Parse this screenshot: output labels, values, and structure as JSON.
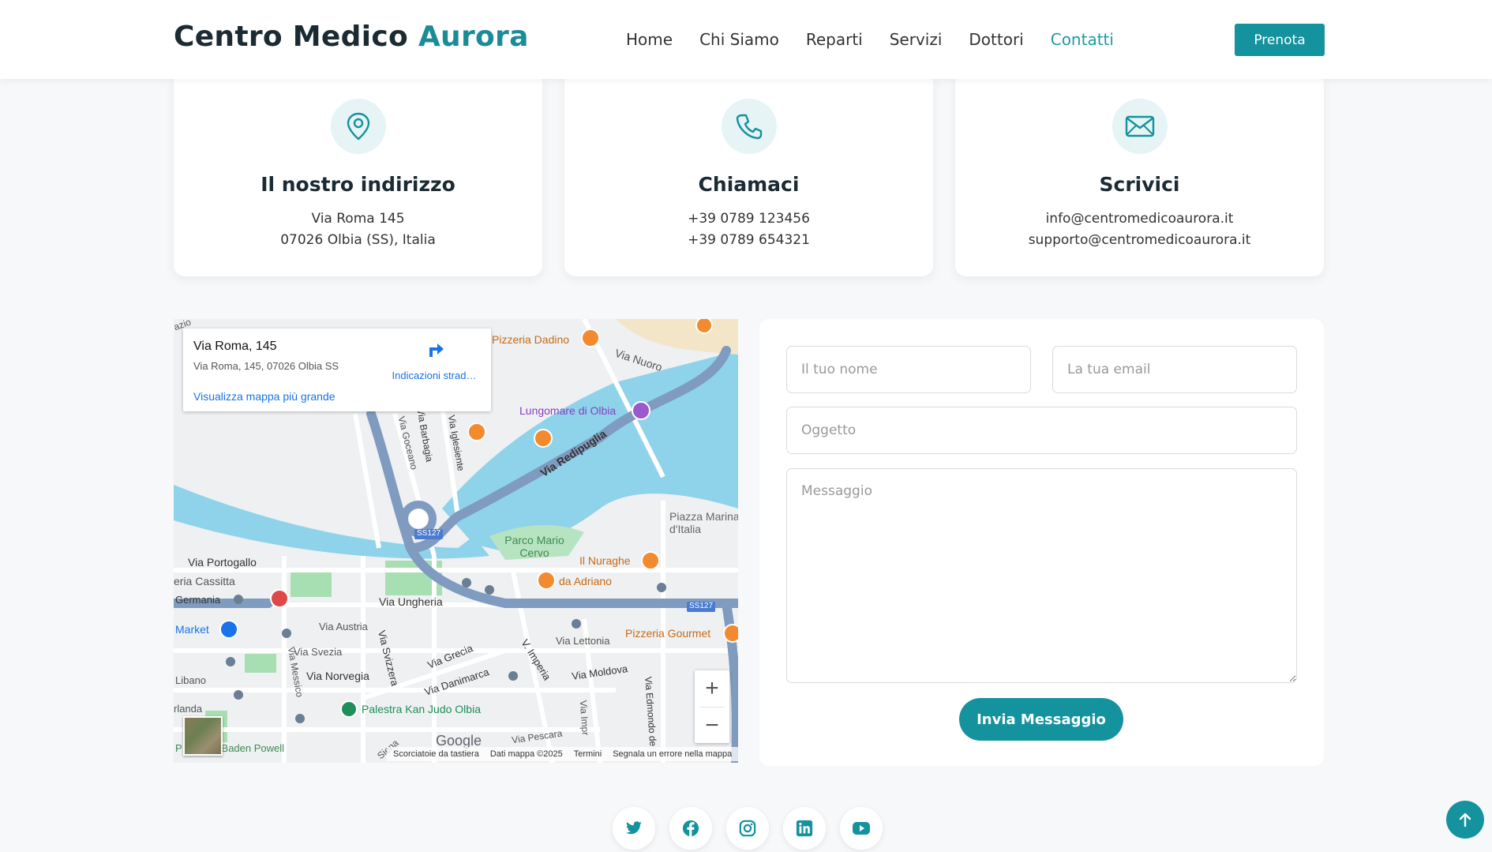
{
  "header": {
    "logo_part1": "Centro Medico ",
    "logo_part2": "Aurora",
    "nav": [
      "Home",
      "Chi Siamo",
      "Reparti",
      "Servizi",
      "Dottori",
      "Contatti"
    ],
    "active_nav": "Contatti",
    "cta_label": "Prenota"
  },
  "cards": [
    {
      "icon": "map-pin-icon",
      "title": "Il nostro indirizzo",
      "lines": [
        "Via Roma 145",
        "07026 Olbia (SS), Italia"
      ]
    },
    {
      "icon": "phone-icon",
      "title": "Chiamaci",
      "lines": [
        "+39 0789 123456",
        "+39 0789 654321"
      ]
    },
    {
      "icon": "envelope-icon",
      "title": "Scrivici",
      "lines": [
        "info@centromedicoaurora.it",
        "supporto@centromedicoaurora.it"
      ]
    }
  ],
  "map": {
    "place_title": "Via Roma, 145",
    "place_address": "Via Roma, 145, 07026 Olbia SS",
    "directions_label": "Indicazioni strad…",
    "bigger_map_label": "Visualizza mappa più grande",
    "zoom_in": "+",
    "zoom_out": "−",
    "google_logo": "Google",
    "footer": [
      "Scorciatoie da tastiera",
      "Dati mappa ©2025",
      "Termini",
      "Segnala un errore nella mappa"
    ],
    "labels": {
      "pizzeria_dadino": "Pizzeria Dadino",
      "via_nuoro": "Via Nuoro",
      "lungomare": "Lungomare di Olbia",
      "via_redipuglia": "Via Redipuglia",
      "via_goceano": "Via Goceano",
      "via_barbagia": "Via Barbagia",
      "via_iglesiente": "Via Iglesiente",
      "piazza_marina": "Piazza Marina d'Italia",
      "parco": "Parco Mario Cervo",
      "nuraghe": "Il Nuraghe",
      "adriano": "da Adriano",
      "ss127_a": "SS127",
      "ss127_b": "SS127",
      "via_portogallo": "Via Portogallo",
      "cassitta": "eria Cassitta",
      "germania": "Germania",
      "via_ungheria": "Via Ungheria",
      "market": "Market",
      "via_austria": "Via Austria",
      "via_svezia": "Via Svezia",
      "via_svizzera": "Via Svizzera",
      "via_messico": "Via Messico",
      "libano": "Libano",
      "via_norvegia": "Via Norvegia",
      "via_grecia": "Via Grecia",
      "via_danimarca": "Via Danimarca",
      "via_imperia": "V. Imperia",
      "via_lettonia": "Via Lettonia",
      "pizzeria_gourmet": "Pizzeria Gourmet",
      "via_moldova": "Via Moldova",
      "via_edmondo": "Via Edmondo de",
      "palestra": "Palestra Kan Judo Olbia",
      "landa": "rlanda",
      "baden": "P… obert Baden Powell",
      "via_pescara": "Via Pescara",
      "siena": "Siena",
      "via_impr": "Via Impr",
      "azio": "azio"
    }
  },
  "form": {
    "name_placeholder": "Il tuo nome",
    "email_placeholder": "La tua email",
    "subject_placeholder": "Oggetto",
    "message_placeholder": "Messaggio",
    "submit_label": "Invia Messaggio"
  },
  "social": [
    "twitter-icon",
    "facebook-icon",
    "instagram-icon",
    "linkedin-icon",
    "youtube-icon"
  ],
  "colors": {
    "accent": "#14929e",
    "accent_light": "#e6f4f5",
    "water": "#8ed3ea",
    "park": "#a8dfb2"
  }
}
